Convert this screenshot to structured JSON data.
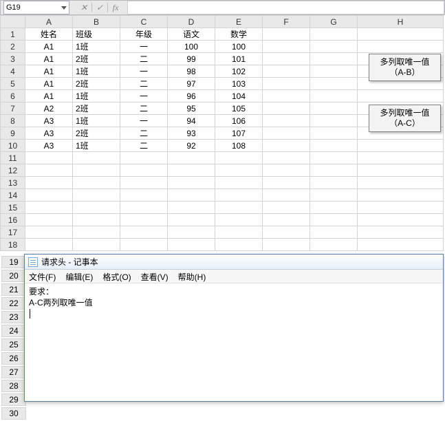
{
  "formula_bar": {
    "cell_ref": "G19",
    "cancel": "✕",
    "confirm": "✓",
    "fx": "fx"
  },
  "columns": [
    "A",
    "B",
    "C",
    "D",
    "E",
    "F",
    "G",
    "H"
  ],
  "row_headers_upper": [
    "1",
    "2",
    "3",
    "4",
    "5",
    "6",
    "7",
    "8",
    "9",
    "10",
    "11",
    "12",
    "13",
    "14",
    "15",
    "16",
    "17",
    "18"
  ],
  "row_headers_behind": [
    "19",
    "20",
    "21",
    "22",
    "23",
    "24",
    "25",
    "26",
    "27",
    "28",
    "29",
    "30"
  ],
  "chart_data": {
    "type": "table",
    "headers": [
      "姓名",
      "班级",
      "年级",
      "语文",
      "数学"
    ],
    "rows": [
      [
        "A1",
        "1班",
        "一",
        "100",
        "100"
      ],
      [
        "A1",
        "2班",
        "二",
        "99",
        "101"
      ],
      [
        "A1",
        "1班",
        "一",
        "98",
        "102"
      ],
      [
        "A1",
        "2班",
        "二",
        "97",
        "103"
      ],
      [
        "A1",
        "1班",
        "一",
        "96",
        "104"
      ],
      [
        "A2",
        "2班",
        "二",
        "95",
        "105"
      ],
      [
        "A3",
        "1班",
        "一",
        "94",
        "106"
      ],
      [
        "A3",
        "2班",
        "二",
        "93",
        "107"
      ],
      [
        "A3",
        "1班",
        "二",
        "92",
        "108"
      ]
    ]
  },
  "shapes": {
    "btn1_l1": "多列取唯一值",
    "btn1_l2": "（A-B）",
    "btn2_l1": "多列取唯一值",
    "btn2_l2": "（A-C）"
  },
  "notepad": {
    "title": "请求头 - 记事本",
    "menu": [
      "文件(F)",
      "编辑(E)",
      "格式(O)",
      "查看(V)",
      "帮助(H)"
    ],
    "lines": [
      "要求：",
      "A-C两列取唯一值"
    ]
  }
}
